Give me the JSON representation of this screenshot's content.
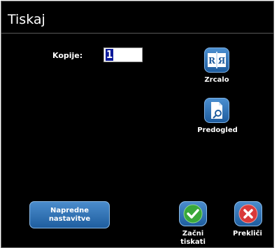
{
  "dialog": {
    "title": "Tiskaj",
    "copies_label": "Kopije:",
    "copies_value": "1"
  },
  "buttons": {
    "mirror_label": "Zrcalo",
    "preview_label": "Predogled",
    "advanced_label_line1": "Napredne",
    "advanced_label_line2": "nastavitve",
    "start_label_line1": "Začni",
    "start_label_line2": "tiskati",
    "cancel_label": "Prekliči"
  },
  "icons": {
    "mirror": "mirror-icon",
    "preview": "print-preview-icon",
    "start": "checkmark-icon",
    "cancel": "close-icon"
  },
  "colors": {
    "background": "#000000",
    "button_blue": "#1e5c9e",
    "ok_green": "#39a83a",
    "cancel_red": "#d93a3a",
    "selection": "#0c1a9a"
  }
}
